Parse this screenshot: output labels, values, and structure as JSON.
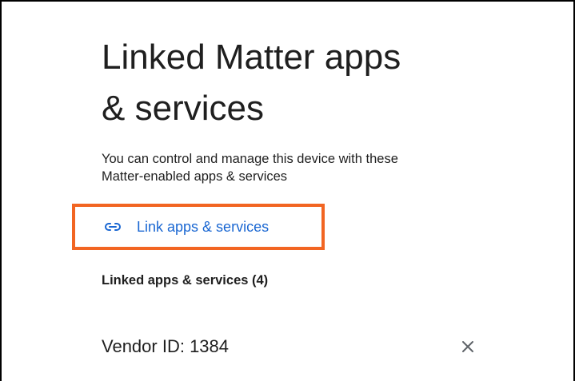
{
  "page": {
    "title_line1": "Linked Matter apps",
    "title_line2": "& services",
    "description_line1": "You can control and manage this device with these",
    "description_line2": "Matter-enabled apps & services"
  },
  "link_button": {
    "label": "Link apps & services",
    "icon": "link-icon",
    "highlight_color": "#f26522",
    "text_color": "#1a67d2"
  },
  "linked_section": {
    "heading": "Linked apps & services (4)",
    "items": [
      {
        "label": "Vendor ID: 1384",
        "remove_icon": "close-icon"
      }
    ]
  }
}
